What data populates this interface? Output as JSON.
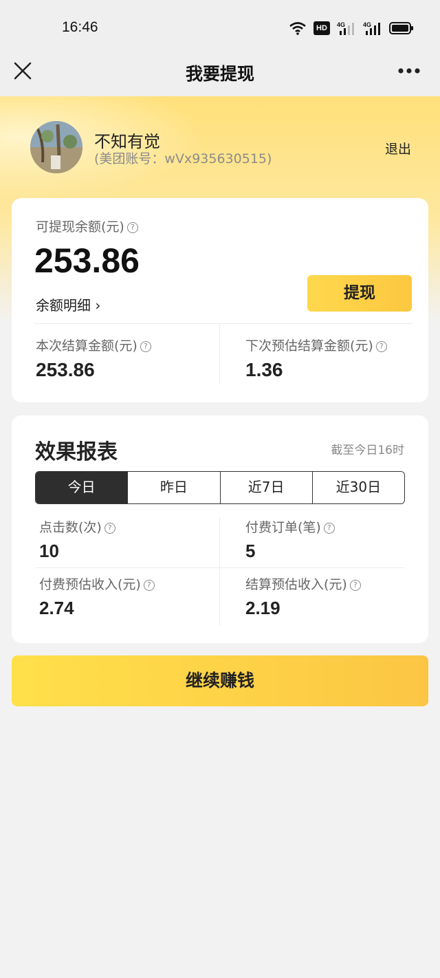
{
  "status_bar": {
    "time": "16:46",
    "icons": [
      "wifi-icon",
      "hd-icon",
      "4g-signal-icon",
      "4g-signal-icon",
      "battery-icon"
    ],
    "hd_label": "HD",
    "network_label": "4G"
  },
  "nav": {
    "title": "我要提现",
    "close_icon": "close-icon",
    "more_icon": "more-icon"
  },
  "user": {
    "name": "不知有觉",
    "account": "(美团账号：wVx935630515)",
    "logout": "退出"
  },
  "balance": {
    "label": "可提现余额(元)",
    "amount": "253.86",
    "detail_link": "余额明细 ›",
    "withdraw_button": "提现",
    "current_settle_label": "本次结算金额(元)",
    "current_settle_value": "253.86",
    "next_settle_label": "下次预估结算金额(元)",
    "next_settle_value": "1.36"
  },
  "report": {
    "title": "效果报表",
    "as_of": "截至今日16时",
    "tabs": [
      "今日",
      "昨日",
      "近7日",
      "近30日"
    ],
    "active_tab": "今日",
    "stats": [
      {
        "label": "点击数(次)",
        "value": "10"
      },
      {
        "label": "付费订单(笔)",
        "value": "5"
      },
      {
        "label": "付费预估收入(元)",
        "value": "2.74"
      },
      {
        "label": "结算预估收入(元)",
        "value": "2.19"
      }
    ]
  },
  "continue_button": "继续赚钱",
  "colors": {
    "accent_yellow": "#fcc840",
    "background": "#f2f2f2",
    "active_tab": "#2e2e2e"
  }
}
